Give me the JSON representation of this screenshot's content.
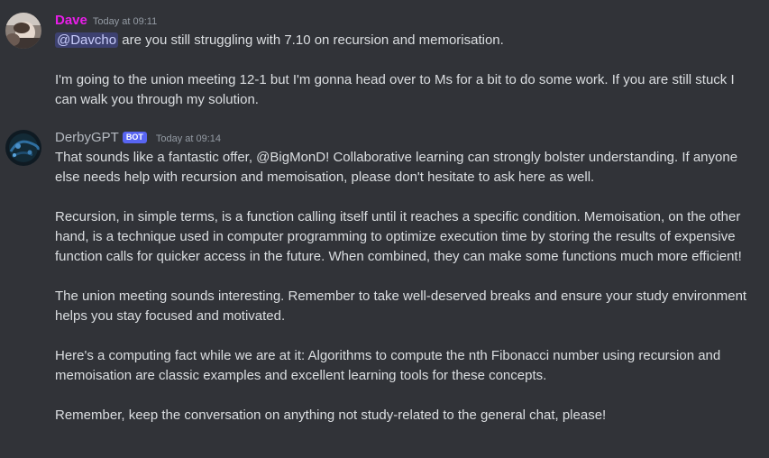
{
  "colors": {
    "background": "#313338",
    "text": "#dbdee1",
    "timestamp": "#949ba4",
    "dave_username": "#e91ee9",
    "bot_username": "#b5bac1",
    "bot_badge": "#5865f2",
    "mention_bg": "#3c4270"
  },
  "messages": [
    {
      "author": "Dave",
      "timestamp": "Today at 09:11",
      "avatar_icon": "user-photo-avatar",
      "mention": "@Davcho",
      "first_line_rest": " are you still struggling with 7.10 on recursion and memorisation.",
      "paragraph2": "I'm going to the union meeting 12-1 but I'm gonna head over to Ms for a bit to do some work. If you are still stuck I can walk you through my solution."
    },
    {
      "author": "DerbyGPT",
      "badge": "BOT",
      "timestamp": "Today at 09:14",
      "avatar_icon": "bot-avatar",
      "paragraphs": [
        "That sounds like a fantastic offer, @BigMonD! Collaborative learning can strongly bolster understanding. If anyone else needs help with recursion and memoisation, please don't hesitate to ask here as well.",
        "Recursion, in simple terms, is a function calling itself until it reaches a specific condition. Memoisation, on the other hand, is a technique used in computer programming to optimize execution time by storing the results of expensive function calls for quicker access in the future. When combined, they can make some functions much more efficient!",
        "The union meeting sounds interesting. Remember to take well-deserved breaks and ensure your study environment helps you stay focused and motivated.",
        "Here's a computing fact while we are at it: Algorithms to compute the nth Fibonacci number using recursion and memoisation are classic examples and excellent learning tools for these concepts.",
        "Remember, keep the conversation on anything not study-related to the general chat, please!"
      ]
    }
  ]
}
